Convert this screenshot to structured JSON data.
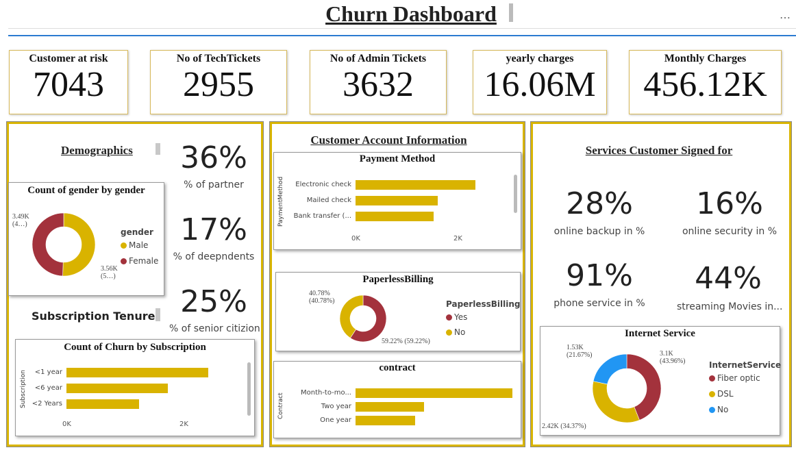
{
  "title": "Churn Dashboard",
  "more_icon": "more-horizontal-icon",
  "kpis": [
    {
      "label": "Customer at risk",
      "value": "7043"
    },
    {
      "label": "No of TechTickets",
      "value": "2955"
    },
    {
      "label": "No of Admin Tickets",
      "value": "3632"
    },
    {
      "label": "yearly charges",
      "value": "16.06M"
    },
    {
      "label": "Monthly Charges",
      "value": "456.12K"
    }
  ],
  "demographics": {
    "title": "Demographics",
    "stats": [
      {
        "value": "36%",
        "label": "% of partner"
      },
      {
        "value": "17%",
        "label": "% of deepndents"
      },
      {
        "value": "25%",
        "label": "% of senior citizion"
      }
    ],
    "gender_chart": {
      "title": "Count of gender by gender",
      "legend_title": "gender",
      "legend": [
        "Male",
        "Female"
      ],
      "labels": {
        "female": [
          "3.49K",
          "(4…)"
        ],
        "male": [
          "3.56K",
          "(5…)"
        ]
      }
    },
    "subscription_title": "Subscription Tenure",
    "subscription_chart": {
      "title": "Count of Churn by Subscription",
      "axis_label": "Subscription",
      "ticks": [
        "0K",
        "2K"
      ]
    }
  },
  "account": {
    "title": "Customer Account Information",
    "payment": {
      "title": "Payment Method",
      "axis_label": "PaymentMethod",
      "ticks": [
        "0K",
        "2K"
      ]
    },
    "paperless": {
      "title": "PaperlessBilling",
      "legend_title": "PaperlessBilling",
      "legend": [
        "Yes",
        "No"
      ],
      "labels": {
        "no": [
          "40.78%",
          "(40.78%)"
        ],
        "yes": "59.22% (59.22%)"
      }
    },
    "contract": {
      "title": "contract",
      "axis_label": "Contract"
    }
  },
  "services": {
    "title": "Services Customer Signed for",
    "stats": [
      {
        "value": "28%",
        "label": "online backup in %"
      },
      {
        "value": "16%",
        "label": "online security in %"
      },
      {
        "value": "91%",
        "label": "phone service in %"
      },
      {
        "value": "44%",
        "label": "streaming Movies in..."
      }
    ],
    "internet": {
      "title": "Internet Service",
      "legend_title": "InternetService",
      "legend": [
        "Fiber optic",
        "DSL",
        "No"
      ],
      "labels": {
        "no": [
          "1.53K",
          "(21.67%)"
        ],
        "fiber": [
          "3.1K",
          "(43.96%)"
        ],
        "dsl": "2.42K (34.37%)"
      }
    }
  },
  "colors": {
    "gold": "#D9B300",
    "maroon": "#A3323C",
    "blue": "#2196F3",
    "border": "#D9B500"
  },
  "chart_data": [
    {
      "type": "pie",
      "title": "Count of gender by gender",
      "categories": [
        "Male",
        "Female"
      ],
      "values": [
        3560,
        3490
      ]
    },
    {
      "type": "bar",
      "title": "Count of Churn by Subscription",
      "categories": [
        "<1 year",
        "<6 year",
        "<2 Years"
      ],
      "values": [
        2070,
        1480,
        1060
      ],
      "xlim": [
        0,
        2500
      ]
    },
    {
      "type": "bar",
      "title": "Payment Method",
      "categories": [
        "Electronic check",
        "Mailed check",
        "Bank transfer (..."
      ],
      "values": [
        2365,
        1612,
        1544
      ],
      "xlim": [
        0,
        2900
      ]
    },
    {
      "type": "pie",
      "title": "PaperlessBilling",
      "categories": [
        "Yes",
        "No"
      ],
      "values": [
        59.22,
        40.78
      ]
    },
    {
      "type": "bar",
      "title": "contract",
      "categories": [
        "Month-to-mo...",
        "Two year",
        "One year"
      ],
      "values": [
        3875,
        1695,
        1473
      ],
      "xlim": [
        0,
        3900
      ]
    },
    {
      "type": "pie",
      "title": "Internet Service",
      "categories": [
        "Fiber optic",
        "DSL",
        "No"
      ],
      "values": [
        43.96,
        34.37,
        21.67
      ]
    }
  ]
}
